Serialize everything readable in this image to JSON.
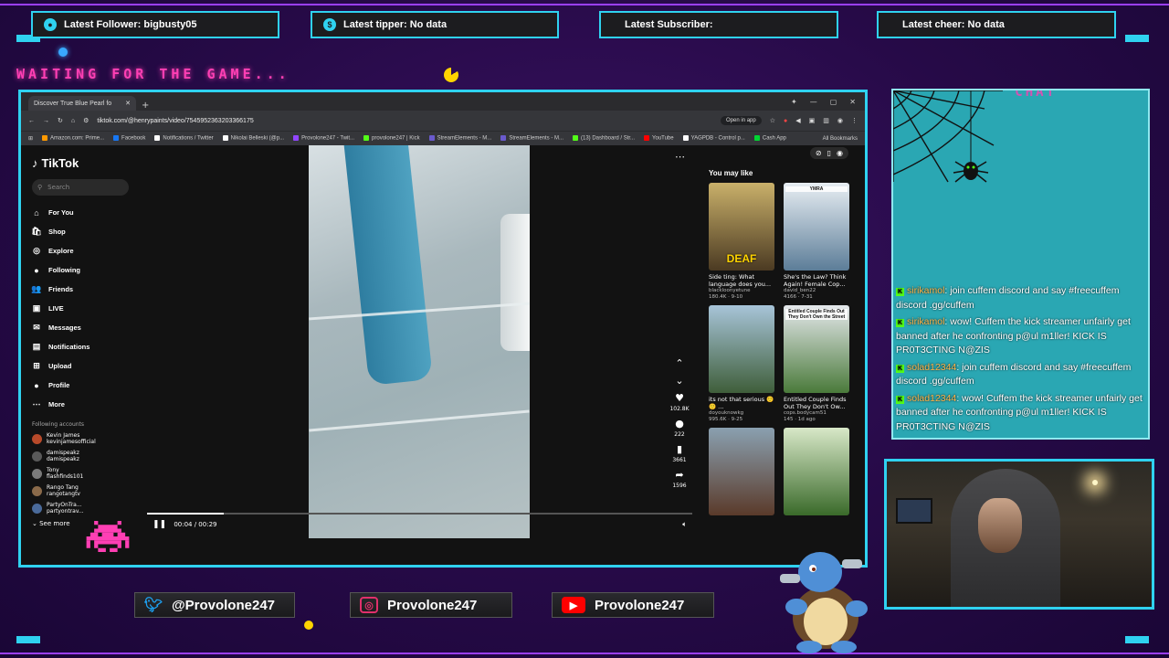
{
  "alerts": {
    "follower": "Latest Follower: bigbusty05",
    "tipper": "Latest tipper: No data",
    "subscriber": "Latest Subscriber:",
    "cheer": "Latest cheer: No data"
  },
  "overlay": {
    "waiting_text": "WAITING FOR THE GAME...",
    "chat_label": "CHAT"
  },
  "browser": {
    "tab_title": "Discover True Blue Pearl fo",
    "url": "tiktok.com/@henrypaints/video/7545952363203366175",
    "open_in_app": "Open in app",
    "bookmarks": [
      {
        "label": "Amazon.com: Prime...",
        "color": "#ff9900"
      },
      {
        "label": "Facebook",
        "color": "#1877f2"
      },
      {
        "label": "Notifications / Twitter",
        "color": "#ffffff"
      },
      {
        "label": "Nikolai Belleski (@p...",
        "color": "#ffffff"
      },
      {
        "label": "Provolone247 - Twit...",
        "color": "#9146ff"
      },
      {
        "label": "provolone247 | Kick",
        "color": "#53fc18"
      },
      {
        "label": "StreamElements - M...",
        "color": "#6a5acd"
      },
      {
        "label": "StreamElements - M...",
        "color": "#6a5acd"
      },
      {
        "label": "(13) Dashboard / Str...",
        "color": "#53fc18"
      },
      {
        "label": "YouTube",
        "color": "#ff0000"
      },
      {
        "label": "YAGPDB - Control p...",
        "color": "#ffffff"
      },
      {
        "label": "Cash App",
        "color": "#00d632"
      }
    ],
    "all_bookmarks": "All Bookmarks"
  },
  "tiktok": {
    "logo": "TikTok",
    "search_placeholder": "Search",
    "nav": [
      {
        "label": "For You",
        "icon": "home-icon",
        "glyph": "⌂"
      },
      {
        "label": "Shop",
        "icon": "shop-icon",
        "glyph": "🛍"
      },
      {
        "label": "Explore",
        "icon": "compass-icon",
        "glyph": "◎"
      },
      {
        "label": "Following",
        "icon": "following-icon",
        "glyph": "●"
      },
      {
        "label": "Friends",
        "icon": "friends-icon",
        "glyph": "👥"
      },
      {
        "label": "LIVE",
        "icon": "live-icon",
        "glyph": "▣"
      },
      {
        "label": "Messages",
        "icon": "messages-icon",
        "glyph": "✉"
      },
      {
        "label": "Notifications",
        "icon": "bell-icon",
        "glyph": "▤"
      },
      {
        "label": "Upload",
        "icon": "upload-icon",
        "glyph": "⊞"
      },
      {
        "label": "Profile",
        "icon": "profile-icon",
        "glyph": "●"
      },
      {
        "label": "More",
        "icon": "more-icon",
        "glyph": "⋯"
      }
    ],
    "following_accounts_title": "Following accounts",
    "following_accounts": [
      {
        "name": "Kevin James",
        "handle": "kevinjamesofficial"
      },
      {
        "name": "damispeakz",
        "handle": "damispeakz"
      },
      {
        "name": "Tony",
        "handle": "flashfinds101"
      },
      {
        "name": "Rango Tang",
        "handle": "rangotangtv"
      },
      {
        "name": "PartyOnTra...",
        "handle": "partyontrav..."
      }
    ],
    "see_more": "See more",
    "player": {
      "time": "00:04 / 00:29",
      "progress": 0.14
    },
    "actions": {
      "likes": "102.8K",
      "comments": "222",
      "saves": "3661",
      "shares": "1596"
    },
    "you_may_like_title": "You may like",
    "suggestions": [
      {
        "caption": "Side ting: What language does you...",
        "author": "blackloonyetune",
        "meta": "180.4K · 9-10",
        "thumb_label": "DEAF"
      },
      {
        "caption": "She's the Law? Think Again! Female Cop...",
        "author": "david_ben22",
        "meta": "4166 · 7-31",
        "thumb_label": "YMRA"
      },
      {
        "caption": "its not that serious 🙂🙂 ...",
        "author": "doyouknowkg",
        "meta": "995.6K · 9-25",
        "thumb_label": ""
      },
      {
        "caption": "Entitled Couple Finds Out They Don't Ow...",
        "author": "cops.bodycam51",
        "meta": "145 · 1d ago",
        "thumb_label": "Entitled Couple Finds Out They Don't Own the Street"
      },
      {
        "caption": "",
        "author": "",
        "meta": "",
        "thumb_label": ""
      },
      {
        "caption": "",
        "author": "",
        "meta": "",
        "thumb_label": ""
      }
    ]
  },
  "chat": {
    "messages": [
      {
        "user": "sirikamol",
        "text": ": join cuffem discord and say #freecuffem discord .gg/cuffem"
      },
      {
        "user": "sirikamol",
        "text": ": wow! Cuffem the kick streamer unfairly get banned after he confronting p@ul m1ller! KICK IS PR0T3CTING N@ZIS"
      },
      {
        "user": "solad12344",
        "text": ": join cuffem discord and say #freecuffem discord .gg/cuffem"
      },
      {
        "user": "solad12344",
        "text": ": wow! Cuffem the kick streamer unfairly get banned after he confronting p@ul m1ller! KICK IS PR0T3CTING N@ZIS"
      }
    ]
  },
  "socials": {
    "twitter": "@Provolone247",
    "instagram": "Provolone247",
    "youtube": "Provolone247"
  },
  "colors": {
    "accent": "#2fd2f0",
    "neon_pink": "#ff3fb4",
    "kick_green": "#53fc18",
    "chat_bg": "#2aa7b3"
  }
}
